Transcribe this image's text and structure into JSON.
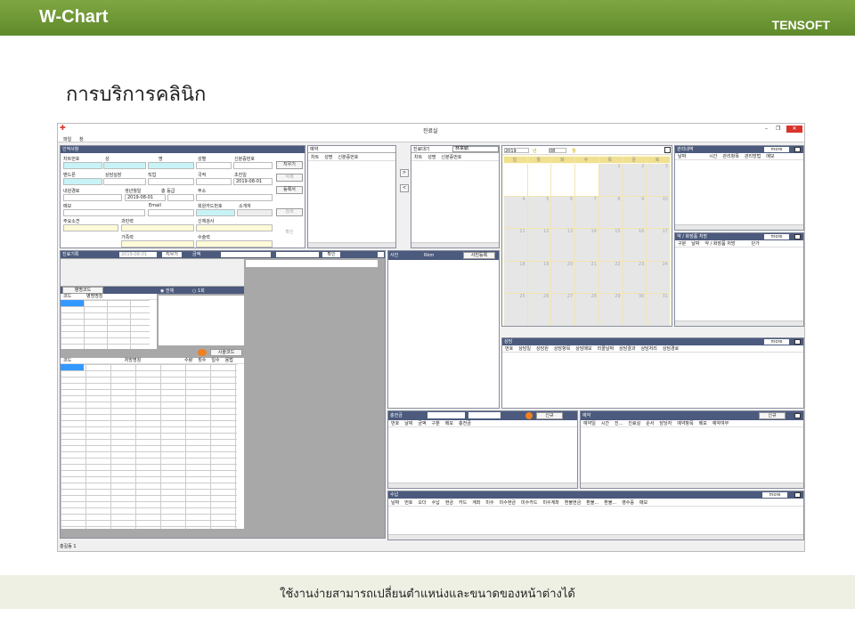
{
  "slide": {
    "brand": "W-Chart",
    "company": "TENSOFT",
    "heading": "การบริการคลินิก",
    "footer": "ใช้งานง่ายสามารถเปลี่ยนตำแหน่งและขนาดของหน้าต่างได้"
  },
  "window": {
    "title": "진료실",
    "menu": [
      "파일",
      "창"
    ],
    "status": "총길동 1"
  },
  "patient": {
    "title": "인적사항",
    "labels": [
      "차트번호",
      "성",
      "명",
      "성별",
      "신분증번호",
      "밴드폰",
      "상담실장",
      "직업",
      "국적",
      "초진일",
      "내원경로",
      "생년월일",
      "총 등급",
      "주소",
      "메모",
      "Email",
      "회원카드번호",
      "소개자",
      "주요소견",
      "과민력",
      "신체검사",
      "가족력",
      "수술력"
    ],
    "first_visit": "2019-08-01",
    "birth": "2019-08-01",
    "buttons": [
      "지우기",
      "삭제",
      "등록서",
      "검색",
      "확인"
    ]
  },
  "reservation": {
    "title": "예약",
    "cols": [
      "차트",
      "성명",
      "신분증번호"
    ]
  },
  "waiting": {
    "title": "진료대기",
    "dropdown": "林韋毓",
    "cols": [
      "차트",
      "성명",
      "신분증번호"
    ],
    "arrows": [
      ">",
      "<"
    ]
  },
  "calendar": {
    "year": "2019",
    "year_unit": "년",
    "month": "08",
    "month_unit": "월",
    "weekdays": [
      "일",
      "월",
      "화",
      "수",
      "목",
      "금",
      "토"
    ],
    "days": [
      "",
      "",
      "",
      "",
      "1",
      "2",
      "3",
      "4",
      "5",
      "6",
      "7",
      "8",
      "9",
      "10",
      "11",
      "12",
      "13",
      "14",
      "15",
      "16",
      "17",
      "18",
      "19",
      "20",
      "21",
      "22",
      "23",
      "24",
      "25",
      "26",
      "27",
      "28",
      "29",
      "30",
      "31"
    ]
  },
  "care": {
    "title": "관리내역",
    "more": "more",
    "cols": [
      "날짜",
      "시간",
      "관리항목",
      "관리방법",
      "메모"
    ]
  },
  "meds": {
    "title": "약 / 화장품 처방",
    "more": "more",
    "cols": [
      "구분",
      "날짜",
      "약 / 화장품 처방",
      "단가"
    ]
  },
  "record": {
    "title": "진료기록",
    "date": "2019-08-01",
    "clear": "지우기",
    "amount": "금액",
    "confirm": "확인",
    "disease_code": "병명코드",
    "disease_cols": [
      "코드",
      "병명명칭"
    ],
    "radio1": "전체",
    "radio2": "1회",
    "surgery_code": "시술코드",
    "rx_cols": [
      "코드",
      "처방명칭",
      "수량",
      "횟수",
      "일수",
      "용법"
    ]
  },
  "photo": {
    "title": "사진",
    "size": "Rkm",
    "register": "사진등록"
  },
  "consult": {
    "title": "상담",
    "more": "more",
    "cols": [
      "번호",
      "상담일",
      "상담원",
      "상담항목",
      "상담메모",
      "리콜날짜",
      "상담결과",
      "상담처리",
      "상담경로"
    ]
  },
  "deposit": {
    "title": "충전금",
    "new": "신규",
    "cols": [
      "번호",
      "날짜",
      "금액",
      "구분",
      "메모",
      "충전금"
    ]
  },
  "appoint": {
    "title": "예약",
    "new": "신규",
    "cols": [
      "예약일",
      "시간",
      "진...",
      "진료실",
      "순서",
      "담당자",
      "예약항목",
      "메모",
      "예약여부"
    ]
  },
  "payment": {
    "title": "수납",
    "more": "more",
    "cols": [
      "날짜",
      "번호",
      "오더",
      "수납",
      "현금",
      "카드",
      "계좌",
      "미수",
      "미수현금",
      "미수카드",
      "미수계좌",
      "환불현금",
      "환불...",
      "환불...",
      "영수증",
      "메모"
    ]
  },
  "colors": {
    "accent": "#5f8a2b",
    "panel_header": "#4b5a7d",
    "close": "#d9342b"
  }
}
